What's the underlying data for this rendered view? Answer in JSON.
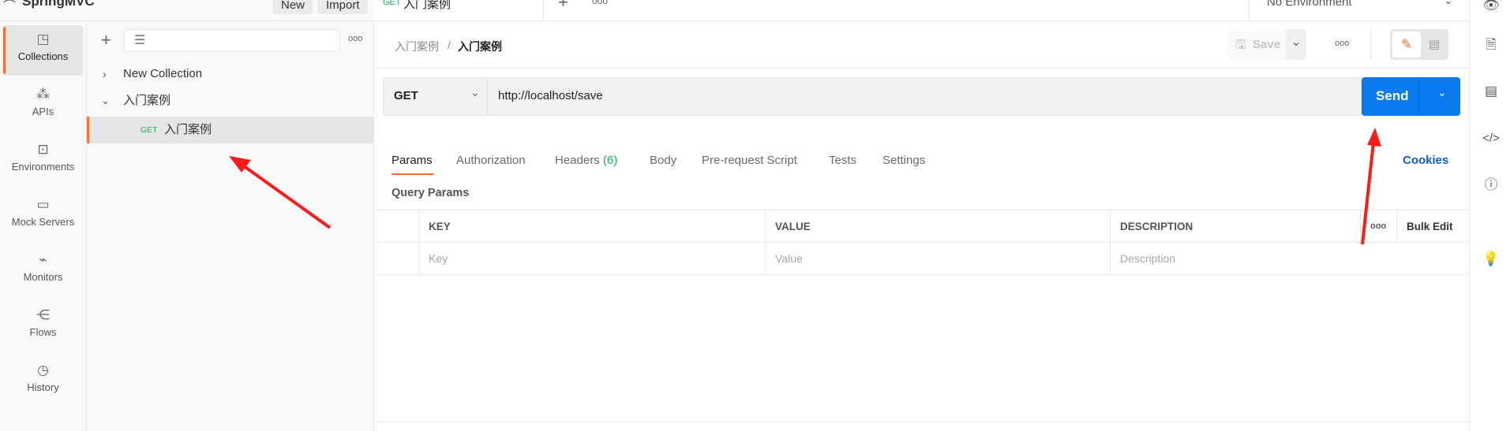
{
  "workspace": {
    "name": "SpringMVC",
    "new_label": "New",
    "import_label": "Import"
  },
  "tabs": [
    {
      "method": "GET",
      "label": "入门案例"
    }
  ],
  "environment": "No Environment",
  "nav": [
    {
      "label": "Collections",
      "icon": "collections-icon"
    },
    {
      "label": "APIs",
      "icon": "apis-icon"
    },
    {
      "label": "Environments",
      "icon": "environments-icon"
    },
    {
      "label": "Mock Servers",
      "icon": "mock-servers-icon"
    },
    {
      "label": "Monitors",
      "icon": "monitors-icon"
    },
    {
      "label": "Flows",
      "icon": "flows-icon"
    },
    {
      "label": "History",
      "icon": "history-icon"
    }
  ],
  "sidebar": {
    "more": "ooo",
    "tree": [
      {
        "label": "New Collection",
        "expanded": false
      },
      {
        "label": "入门案例",
        "expanded": true,
        "children": [
          {
            "method": "GET",
            "label": "入门案例"
          }
        ]
      }
    ]
  },
  "request": {
    "breadcrumb_parent": "入门案例",
    "breadcrumb_sep": "/",
    "breadcrumb_current": "入门案例",
    "save_label": "Save",
    "more": "ooo",
    "method": "GET",
    "url": "http://localhost/save",
    "send_label": "Send",
    "tabs": [
      "Params",
      "Authorization",
      "Headers",
      "Body",
      "Pre-request Script",
      "Tests",
      "Settings"
    ],
    "headers_count": "(6)",
    "active_tab": "Params",
    "cookies_label": "Cookies",
    "query_params_title": "Query Params",
    "table": {
      "headers": [
        "KEY",
        "VALUE",
        "DESCRIPTION"
      ],
      "more": "ooo",
      "bulk_edit": "Bulk Edit",
      "placeholders": [
        "Key",
        "Value",
        "Description"
      ]
    }
  },
  "colors": {
    "accent": "#ff6c37",
    "send": "#097bed",
    "get": "#0cbb52",
    "arrow": "#ff1a1a"
  }
}
